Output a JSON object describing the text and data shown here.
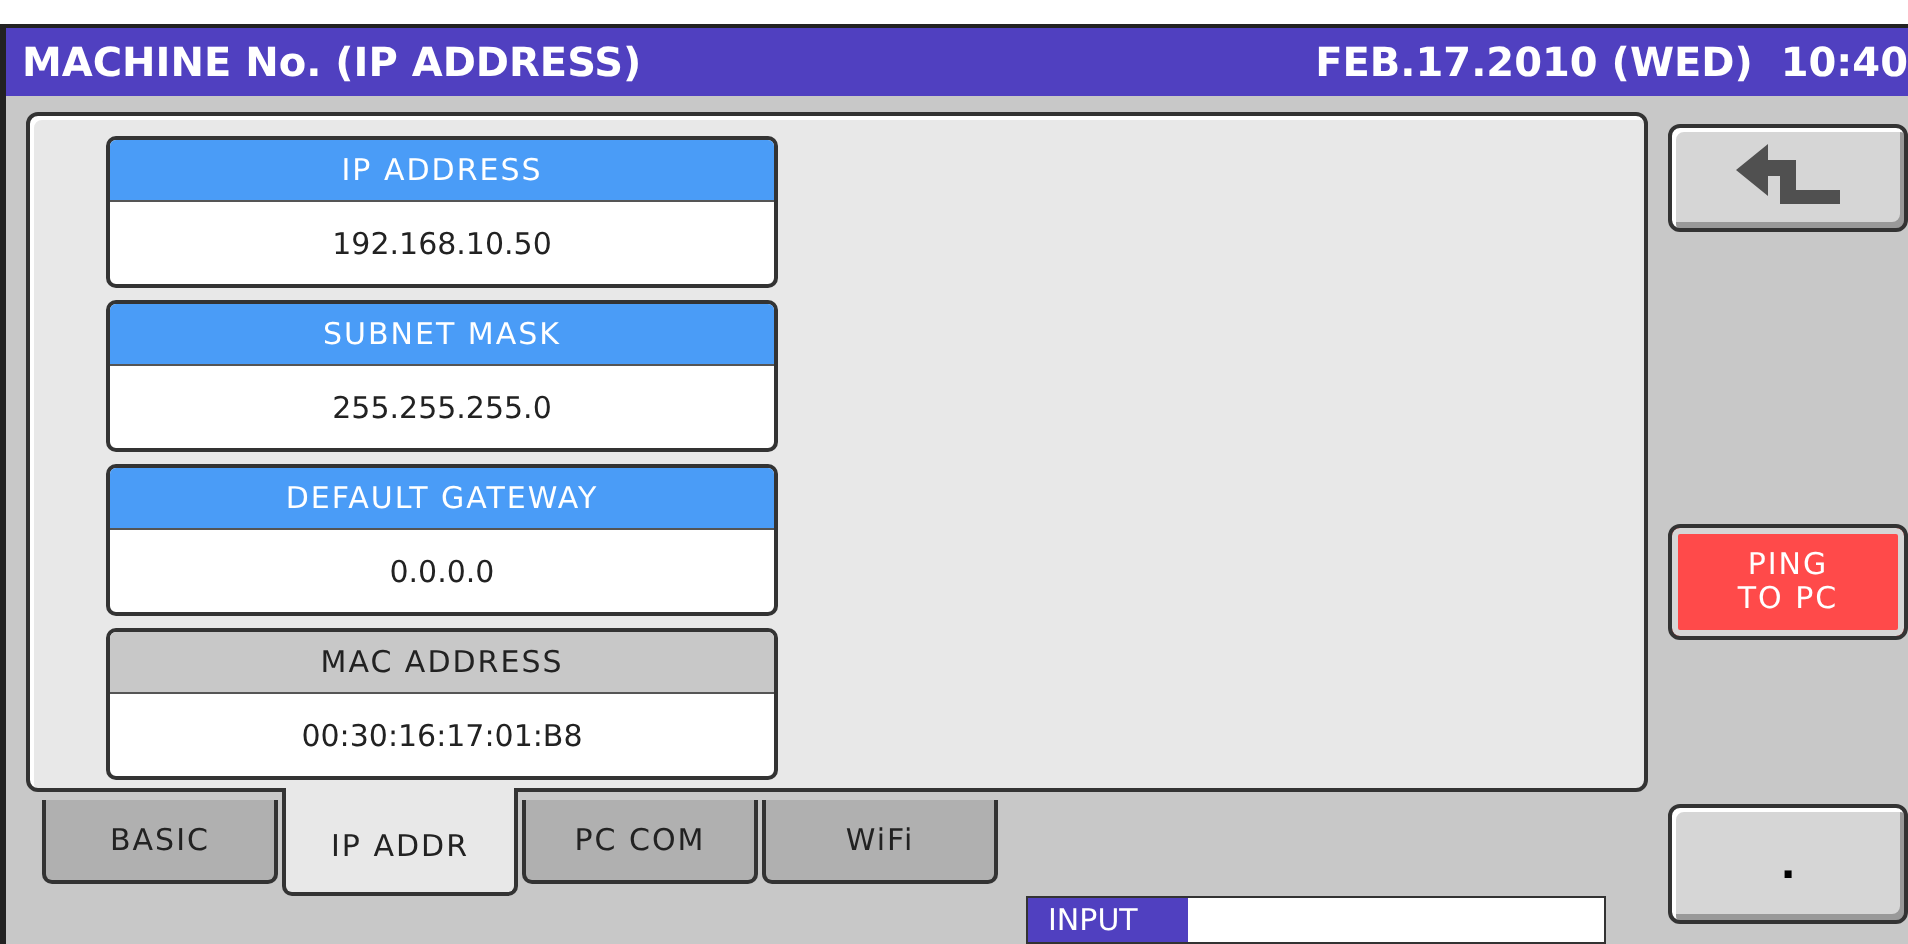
{
  "title_bar": {
    "title": "MACHINE No. (IP ADDRESS)",
    "datetime": "FEB.17.2010 (WED)  10:40"
  },
  "fields": [
    {
      "label": "IP ADDRESS",
      "value": "192.168.10.50",
      "editable": true
    },
    {
      "label": "SUBNET MASK",
      "value": "255.255.255.0",
      "editable": true
    },
    {
      "label": "DEFAULT GATEWAY",
      "value": "0.0.0.0",
      "editable": true
    },
    {
      "label": "MAC ADDRESS",
      "value": "00:30:16:17:01:B8",
      "editable": false
    }
  ],
  "side_buttons": {
    "ping": "PING\nTO PC",
    "dot": "."
  },
  "tabs": [
    {
      "label": "BASIC",
      "selected": false
    },
    {
      "label": "IP ADDR",
      "selected": true
    },
    {
      "label": "PC COM",
      "selected": false
    },
    {
      "label": "WiFi",
      "selected": false
    }
  ],
  "input": {
    "label": "INPUT"
  }
}
